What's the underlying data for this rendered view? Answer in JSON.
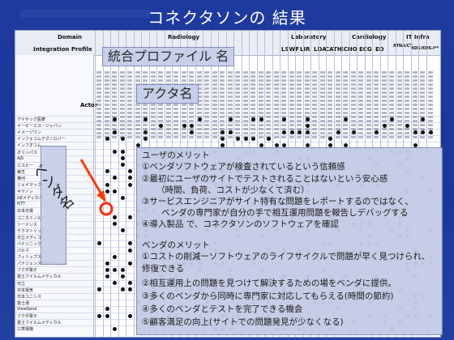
{
  "slide": {
    "title": "コネクタソンの 結果",
    "label_profile": "統合プロファイル 名",
    "label_actor": "アクタ名",
    "label_vendor": "ベンダ名"
  },
  "matrix": {
    "domain_label": "Domain",
    "profile_label": "Integration Profile",
    "actor_label": "Actor",
    "domains": [
      "Radiology",
      "Laboratory",
      "Cardiology",
      "IT Infra"
    ],
    "profiles_lab": [
      "LSWF",
      "LIR",
      "LDA"
    ],
    "profiles_card": [
      "CATH",
      "ECHO",
      "ECG",
      "ED"
    ],
    "profiles_it": [
      "ATNA/CT",
      "XDS/XDS-I**"
    ],
    "vendors": [
      "アイサック医療",
      "イーピーエス・ジャパン",
      "イメージワン",
      "インフォコムテクノロジー",
      "インフオコム",
      "オリンパス",
      "AJS",
      "エスビー",
      "東芝",
      "横河",
      "ジェイマックシステム",
      "キヤノン",
      "GEメディカル",
      "NTT",
      "日本光電",
      "コニカミノルタ",
      "シーメンス",
      "テクマトリックス",
      "日立メディコ",
      "パナソニック",
      "パルマ",
      "フィリップス",
      "パナジェンスMSメディカル",
      "フクダ電子",
      "富士フイルムメディカル",
      "日立",
      "日本電気",
      "日本ユニシス",
      "富士通",
      "ViewSend",
      "フクダ電子",
      "富士フイルムメディカル",
      "三菱電機"
    ]
  },
  "panel": {
    "user_heading": "ユーザのメリット",
    "user_items": [
      "①ベンダソフトウェアが検査されているという信頼感",
      "②最初にユーザのサイトでテストされることはないという安心感",
      "（時間、負荷、コストが少なくて済む）",
      "③サービスエンジニアがサイト特有な問題をレポートするのではなく、",
      "ベンダの専門家が自分の手で相互運用問題を報告しデバッグする",
      "④導入製品 で、コネクタソンのソフトウェアを確認"
    ],
    "vendor_heading": "ベンダのメリット",
    "vendor_items": [
      "①コストの削減ーソフトウェアのライフサイクルで問題が早く見つけられ、",
      "修復できる",
      "②相互運用上の問題を見つけて解決するための場をベンダに提供。",
      "③多くのベンダから同時に専門家に対応してもらえる(時間の節約)",
      "④多くのベンダとテストを完了できる機会",
      "⑤顧客満足の向上(サイトでの問題発見が少なくなる)"
    ]
  },
  "colors": {
    "background": "#1e3a9e",
    "overlay": "#c6cde8",
    "arrow": "#ff3b00",
    "highlight_circle": "#ff2a00"
  }
}
